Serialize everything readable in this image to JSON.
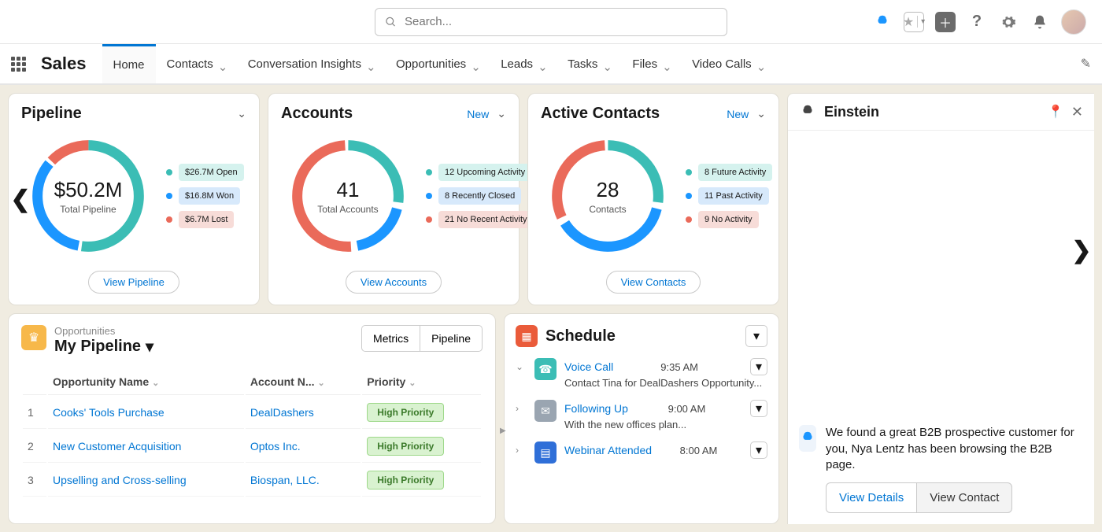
{
  "search": {
    "placeholder": "Search..."
  },
  "app": {
    "name": "Sales"
  },
  "nav": {
    "tabs": [
      {
        "label": "Home",
        "active": true,
        "dropdown": false
      },
      {
        "label": "Contacts",
        "active": false,
        "dropdown": true
      },
      {
        "label": "Conversation Insights",
        "active": false,
        "dropdown": true
      },
      {
        "label": "Opportunities",
        "active": false,
        "dropdown": true
      },
      {
        "label": "Leads",
        "active": false,
        "dropdown": true
      },
      {
        "label": "Tasks",
        "active": false,
        "dropdown": true
      },
      {
        "label": "Files",
        "active": false,
        "dropdown": true
      },
      {
        "label": "Video Calls",
        "active": false,
        "dropdown": true
      }
    ]
  },
  "cards": {
    "pipeline": {
      "title": "Pipeline",
      "center_value": "$50.2M",
      "center_label": "Total Pipeline",
      "legend": [
        {
          "color": "#3bbdb5",
          "label": "$26.7M Open",
          "bg": "#d5f2ee"
        },
        {
          "color": "#1b96ff",
          "label": "$16.8M Won",
          "bg": "#d7e9fb"
        },
        {
          "color": "#ea6a5a",
          "label": "$6.7M Lost",
          "bg": "#f7dcd8"
        }
      ],
      "button": "View Pipeline"
    },
    "accounts": {
      "title": "Accounts",
      "new": "New",
      "center_value": "41",
      "center_label": "Total Accounts",
      "legend": [
        {
          "color": "#3bbdb5",
          "label": "12 Upcoming Activity",
          "bg": "#d5f2ee"
        },
        {
          "color": "#1b96ff",
          "label": "8 Recently Closed",
          "bg": "#d7e9fb"
        },
        {
          "color": "#ea6a5a",
          "label": "21 No Recent Activity",
          "bg": "#f7dcd8"
        }
      ],
      "button": "View Accounts"
    },
    "contacts": {
      "title": "Active Contacts",
      "new": "New",
      "center_value": "28",
      "center_label": "Contacts",
      "legend": [
        {
          "color": "#3bbdb5",
          "label": "8 Future Activity",
          "bg": "#d5f2ee"
        },
        {
          "color": "#1b96ff",
          "label": "11 Past Activity",
          "bg": "#d7e9fb"
        },
        {
          "color": "#ea6a5a",
          "label": "9 No Activity",
          "bg": "#f7dcd8"
        }
      ],
      "button": "View Contacts"
    }
  },
  "opportunities": {
    "subhead": "Opportunities",
    "title": "My Pipeline",
    "seg": [
      "Metrics",
      "Pipeline"
    ],
    "columns": [
      "Opportunity Name",
      "Account N...",
      "Priority"
    ],
    "rows": [
      {
        "n": "1",
        "name": "Cooks' Tools Purchase",
        "account": "DealDashers",
        "priority": "High Priority"
      },
      {
        "n": "2",
        "name": "New Customer Acquisition",
        "account": "Optos Inc.",
        "priority": "High Priority"
      },
      {
        "n": "3",
        "name": "Upselling and Cross-selling",
        "account": "Biospan, LLC.",
        "priority": "High Priority"
      }
    ]
  },
  "schedule": {
    "title": "Schedule",
    "items": [
      {
        "icon": "teal",
        "title": "Voice Call",
        "time": "9:35 AM",
        "desc": "Contact Tina for DealDashers Opportunity...",
        "expanded": true
      },
      {
        "icon": "gray",
        "title": "Following Up",
        "time": "9:00 AM",
        "desc": "With the new offices plan...",
        "expanded": false
      },
      {
        "icon": "blue",
        "title": "Webinar Attended",
        "time": "8:00 AM",
        "desc": "",
        "expanded": false
      }
    ]
  },
  "einstein": {
    "title": "Einstein",
    "message": "We found a great B2B prospective customer for you, Nya Lentz has been browsing the B2B page.",
    "actions": [
      "View Details",
      "View Contact"
    ]
  },
  "chart_data": [
    {
      "type": "pie",
      "title": "Pipeline",
      "total": 50.2,
      "unit": "$M",
      "slices": [
        {
          "name": "Open",
          "value": 26.7,
          "color": "#3bbdb5"
        },
        {
          "name": "Won",
          "value": 16.8,
          "color": "#1b96ff"
        },
        {
          "name": "Lost",
          "value": 6.7,
          "color": "#ea6a5a"
        }
      ]
    },
    {
      "type": "pie",
      "title": "Accounts",
      "total": 41,
      "slices": [
        {
          "name": "Upcoming Activity",
          "value": 12,
          "color": "#3bbdb5"
        },
        {
          "name": "Recently Closed",
          "value": 8,
          "color": "#1b96ff"
        },
        {
          "name": "No Recent Activity",
          "value": 21,
          "color": "#ea6a5a"
        }
      ]
    },
    {
      "type": "pie",
      "title": "Active Contacts",
      "total": 28,
      "slices": [
        {
          "name": "Future Activity",
          "value": 8,
          "color": "#3bbdb5"
        },
        {
          "name": "Past Activity",
          "value": 11,
          "color": "#1b96ff"
        },
        {
          "name": "No Activity",
          "value": 9,
          "color": "#ea6a5a"
        }
      ]
    }
  ]
}
